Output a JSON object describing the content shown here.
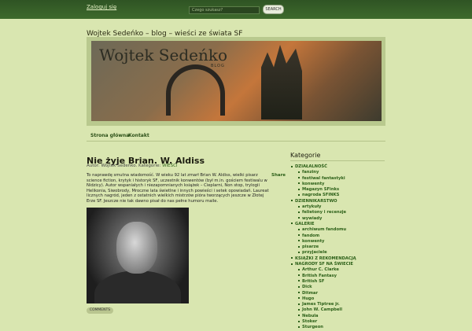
{
  "topbar": {
    "login_label": "Zaloguj się",
    "search_placeholder": "Czego szukasz?",
    "search_button": "SEARCH"
  },
  "site": {
    "title": "Wojtek Sedeńko – blog – wieści ze świata SF",
    "logo_text": "Wojtek Sedeńko",
    "logo_sub": "BLOG"
  },
  "nav": {
    "items": [
      "Strona główna",
      "Kontakt"
    ]
  },
  "post": {
    "title": "Nie żyje Brian. W. Aldiss",
    "meta_prefix": "Autor: Wojtek Sedeńko. Kategorie:",
    "meta_category": "WIEŚCI",
    "share_label": "Share",
    "body": "To naprawdę smutna wiadomość. W wieku 92 lat zmarł Brian W. Aldiss, wielki pisarz science fiction, krytyk i historyk SF, uczestnik konwentów (był m.in. gościem festiwalu w Nidzicy). Autor wspaniałych i niezapomnianych książek – Cieplarni, Non stop, trylogii Helikonia, Siwobrody, Mroczne lata świetlne i innych powieści i setek opowiadań. Laureat licznych nagród, jeden z ostatnich wielkich mistrzów pióra tworzących jeszcze w Złotej Erze SF. Jeszcze nie tak dawno pisał do nas pełne humoru maile.",
    "comments_label": "COMMENTS"
  },
  "sidebar": {
    "title": "Kategorie",
    "categories": [
      {
        "label": "DZIAŁALNOŚĆ",
        "level": 0
      },
      {
        "label": "fanziny",
        "level": 1
      },
      {
        "label": "festiwal fantastyki",
        "level": 1
      },
      {
        "label": "konwenty",
        "level": 1
      },
      {
        "label": "Magazyn SFinks",
        "level": 1
      },
      {
        "label": "nagroda SFINKS",
        "level": 1
      },
      {
        "label": "DZIENNIKARSTWO",
        "level": 0
      },
      {
        "label": "artykuły",
        "level": 1
      },
      {
        "label": "felietony i recenzje",
        "level": 1
      },
      {
        "label": "wywiady",
        "level": 1
      },
      {
        "label": "GALERIE",
        "level": 0
      },
      {
        "label": "archiwum fandomu",
        "level": 1
      },
      {
        "label": "fandom",
        "level": 1
      },
      {
        "label": "konwenty",
        "level": 1
      },
      {
        "label": "pisarze",
        "level": 1
      },
      {
        "label": "przyjaciele",
        "level": 1
      },
      {
        "label": "KSIĄŻKI Z REKOMENDACJĄ",
        "level": 0
      },
      {
        "label": "NAGRODY SF NA ŚWIECIE",
        "level": 0
      },
      {
        "label": "Arthur C. Clarke",
        "level": 1
      },
      {
        "label": "British Fantasy",
        "level": 1
      },
      {
        "label": "British SF",
        "level": 1
      },
      {
        "label": "Dick",
        "level": 1
      },
      {
        "label": "Ditmar",
        "level": 1
      },
      {
        "label": "Hugo",
        "level": 1
      },
      {
        "label": "James Tiptree jr.",
        "level": 1
      },
      {
        "label": "John W. Campbell",
        "level": 1
      },
      {
        "label": "Nebula",
        "level": 1
      },
      {
        "label": "Stoker",
        "level": 1
      },
      {
        "label": "Sturgeon",
        "level": 1
      }
    ]
  }
}
